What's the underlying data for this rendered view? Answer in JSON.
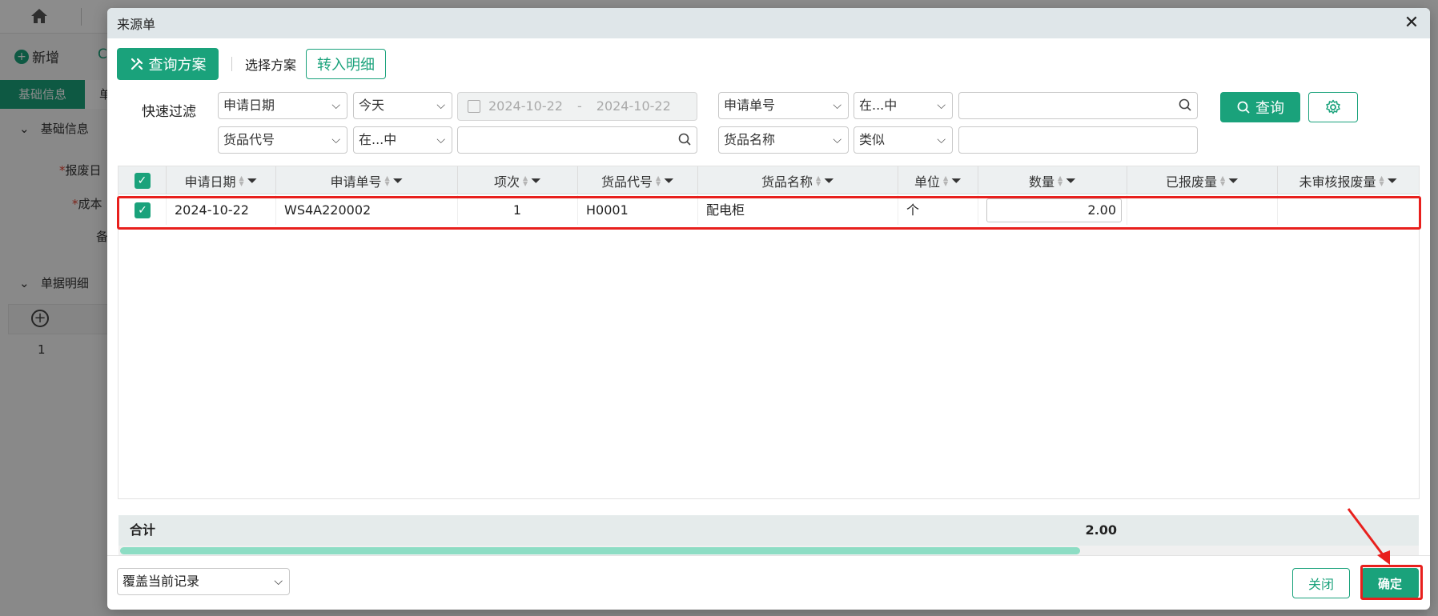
{
  "background_app": {
    "new_label": "新增",
    "c_label": "C",
    "tab_active": "基础信息",
    "tab_other": "单",
    "section_basic": "基础信息",
    "field_scrap_date": "报废日",
    "field_cost": "成本",
    "field_note": "备",
    "section_detail": "单据明细",
    "row_number": "1"
  },
  "modal": {
    "title": "来源单",
    "close_icon": "close-icon",
    "toolbar": {
      "scheme_button": "查询方案",
      "select_scheme_label": "选择方案",
      "to_detail_button": "转入明细"
    },
    "filter": {
      "label": "快速过滤",
      "row1": {
        "field1": "申请日期",
        "op1": "今天",
        "date_from": "2024-10-22",
        "date_sep": "-",
        "date_to": "2024-10-22",
        "field2": "申请单号",
        "op2": "在...中",
        "value2": ""
      },
      "row2": {
        "field1": "货品代号",
        "op1": "在...中",
        "value1": "",
        "field2": "货品名称",
        "op2": "类似",
        "value2": ""
      },
      "query_button": "查询",
      "settings_icon": "gear-icon"
    },
    "grid": {
      "columns": [
        "申请日期",
        "申请单号",
        "项次",
        "货品代号",
        "货品名称",
        "单位",
        "数量",
        "已报废量",
        "未审核报废量"
      ],
      "rows": [
        {
          "checked": true,
          "date": "2024-10-22",
          "number": "WS4A220002",
          "item": "1",
          "code": "H0001",
          "name": "配电柜",
          "unit": "个",
          "qty": "2.00",
          "scrapped": "",
          "unreviewed": ""
        }
      ],
      "footer_label": "合计",
      "footer_qty_total": "2.00",
      "scroll_fraction": 0.74
    },
    "footer": {
      "mode_select": "覆盖当前记录",
      "close_button": "关闭",
      "ok_button": "确定"
    }
  },
  "colors": {
    "primary": "#1aa27b",
    "highlight": "#e8201d"
  }
}
